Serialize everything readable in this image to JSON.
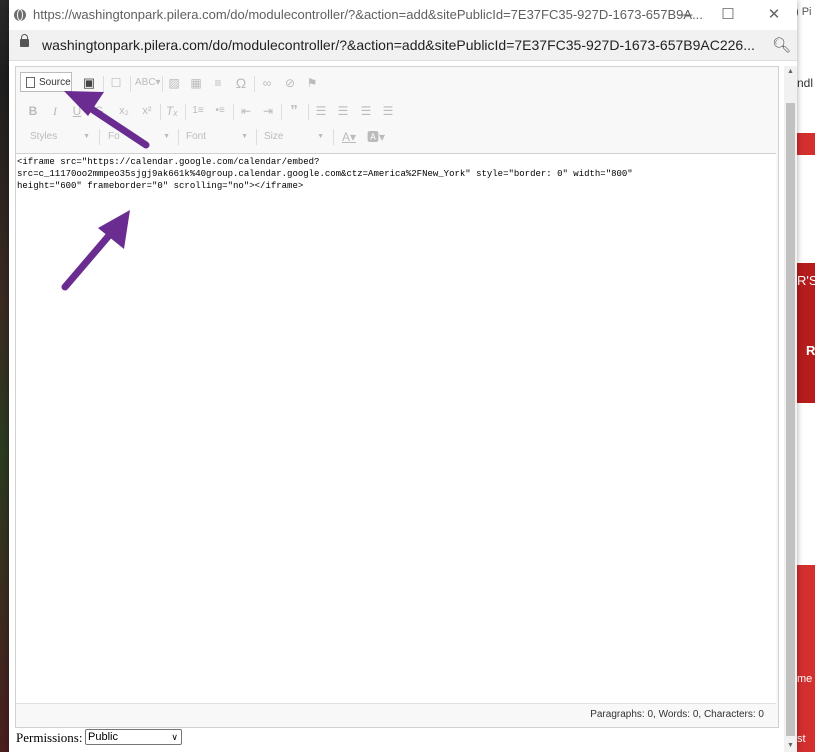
{
  "background_page": {
    "right_snippets": [
      "ndl",
      "R'S",
      "R",
      "me",
      "st"
    ]
  },
  "window": {
    "title": "https://washingtonpark.pilera.com/do/modulecontroller/?&action=add&sitePublicId=7E37FC35-927D-1673-657B9A...",
    "controls": {
      "minimize": "—",
      "maximize": "☐",
      "close": "✕"
    }
  },
  "addressbar": {
    "url": "washingtonpark.pilera.com/do/modulecontroller/?&action=add&sitePublicId=7E37FC35-927D-1673-657B9AC226..."
  },
  "editor": {
    "toolbar": {
      "source_label": "Source",
      "combos": {
        "styles": "Styles",
        "format": "Fo",
        "font": "Font",
        "size": "Size"
      }
    },
    "source_lines": [
      "<iframe src=\"https://calendar.google.com/calendar/embed?",
      "src=c_11170oo2mmpeo35sjgj9ak661k%40group.calendar.google.com&ctz=America%2FNew_York\" style=\"border: 0\" width=\"800\"",
      "height=\"600\" frameborder=\"0\" scrolling=\"no\"></iframe>"
    ],
    "status": "Paragraphs: 0, Words: 0, Characters: 0"
  },
  "permissions": {
    "label": "Permissions:",
    "selected": "Public"
  },
  "colors": {
    "accent_arrow": "#6a2c91",
    "bg_red": "#d32f2f"
  }
}
